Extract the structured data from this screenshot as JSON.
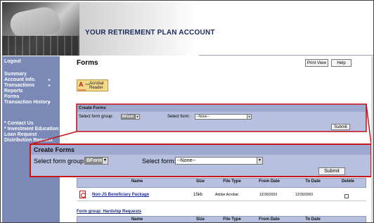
{
  "header": {
    "title": "YOUR RETIREMENT PLAN ACCOUNT"
  },
  "sidebar": {
    "items": [
      {
        "label": "Logout"
      },
      {
        "label": "Summary"
      },
      {
        "label": "Account Info."
      },
      {
        "label": "Transactions"
      },
      {
        "label": "Reports"
      },
      {
        "label": "Forms"
      },
      {
        "label": "Transaction History"
      },
      {
        "label": "* Contact Us"
      },
      {
        "label": "* Investment Education"
      },
      {
        "label": "Loan Request"
      },
      {
        "label": "Distribution Request"
      }
    ]
  },
  "main": {
    "title": "Forms",
    "print_view": "Print View",
    "help": "Help",
    "acrobat": {
      "get": "Get",
      "name_line1": "Acrobat",
      "name_line2": "Reader",
      "adobe": "Adobe"
    }
  },
  "create_forms": {
    "heading": "Create Forms",
    "group_label": "Select form group:",
    "group_value": "BForm",
    "form_label": "Select form:",
    "form_value": "--None--",
    "submit": "Submit"
  },
  "table": {
    "columns": [
      "Name",
      "Size",
      "File Type",
      "From Date",
      "To Date",
      "Delete"
    ],
    "rows": [
      {
        "name": "Non-JS Beneficiary Package",
        "size": "15kb",
        "type": "Adobe Acrobat",
        "from": "12/30/2003",
        "to": "12/30/2003"
      }
    ],
    "group2": "Form group: Hardship Requests"
  },
  "colors": {
    "sidebar": "#7b89b6",
    "panel": "#b7c0de",
    "panel_head": "#9ea9d0",
    "callout": "#c4161c"
  }
}
